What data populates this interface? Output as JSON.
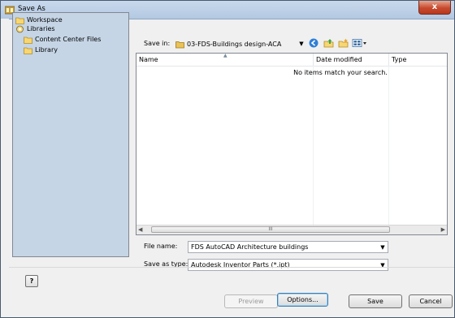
{
  "window": {
    "title": "Save As",
    "close_label": "x"
  },
  "nav": {
    "items": [
      {
        "label": "Workspace",
        "icon": "folder-icon"
      },
      {
        "label": "Libraries",
        "icon": "libraries-icon"
      },
      {
        "label": "Content Center Files",
        "icon": "folder-icon"
      },
      {
        "label": "Library",
        "icon": "folder-icon"
      }
    ]
  },
  "toolbar": {
    "save_in_label": "Save in:",
    "save_in_value": "03-FDS-Buildings design-ACA",
    "icons": [
      "back-icon",
      "up-folder-icon",
      "new-folder-icon",
      "view-menu-icon"
    ]
  },
  "list": {
    "columns": [
      "Name",
      "Date modified",
      "Type"
    ],
    "empty_message": "No items match your search.",
    "scroll_thumb_grip": "III"
  },
  "form": {
    "file_name_label": "File name:",
    "file_name_value": "FDS AutoCAD Architecture buildings",
    "save_type_label": "Save as type:",
    "save_type_value": "Autodesk Inventor Parts (*.ipt)"
  },
  "buttons": {
    "help": "?",
    "preview": "Preview",
    "options": "Options...",
    "save": "Save",
    "cancel": "Cancel"
  }
}
